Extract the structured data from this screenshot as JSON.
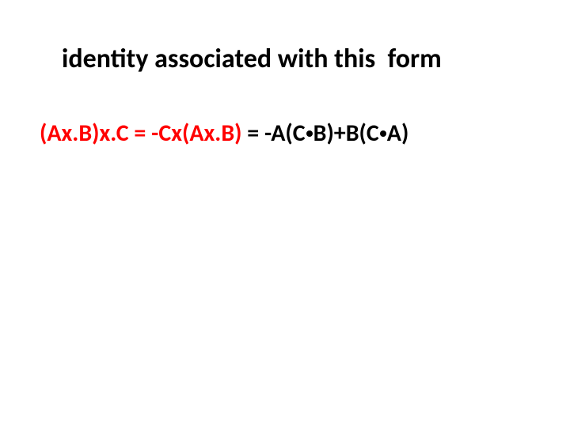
{
  "title": "identity associated with this  form",
  "equation": {
    "lhs_red": "(Ax.B)x.C = -Cx(Ax.B) ",
    "eq_black": "= ",
    "rhs_pre": "-A(C",
    "rhs_mid": "B)+B(C",
    "rhs_post": "A)"
  }
}
